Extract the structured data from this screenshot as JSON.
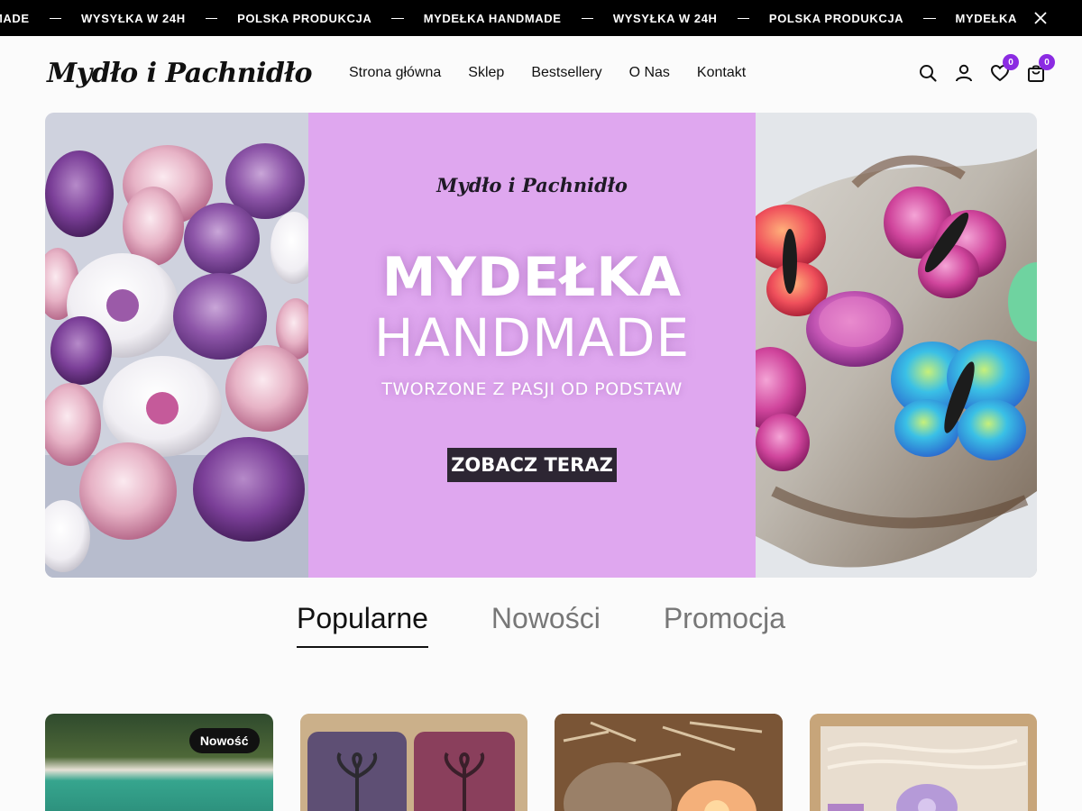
{
  "topbar": {
    "items": [
      "MADE",
      "WYSYŁKA W 24H",
      "POLSKA PRODUKCJA",
      "MYDEŁKA HANDMADE",
      "WYSYŁKA W 24H",
      "POLSKA PRODUKCJA",
      "MYDEŁKA"
    ],
    "close_icon": "close-icon"
  },
  "header": {
    "logo": "Mydło i Pachnidło",
    "nav": [
      "Strona główna",
      "Sklep",
      "Bestsellery",
      "O Nas",
      "Kontakt"
    ],
    "icons": {
      "search": "search-icon",
      "account": "user-icon",
      "wishlist": "heart-icon",
      "cart": "bag-icon"
    },
    "wishlist_count": "0",
    "cart_count": "0",
    "badge_color": "#8b2be2"
  },
  "hero": {
    "brand": "Mydło i Pachnidło",
    "title_line1": "MYDEŁKA",
    "title_line2": "HANDMADE",
    "subtitle": "TWORZONE Z PASJI OD PODSTAW",
    "cta": "ZOBACZ TERAZ",
    "center_color": "#dfa7ef"
  },
  "tabs": {
    "items": [
      "Popularne",
      "Nowości",
      "Promocja"
    ],
    "active": "Popularne"
  },
  "products": {
    "badge_first": "Nowość"
  }
}
